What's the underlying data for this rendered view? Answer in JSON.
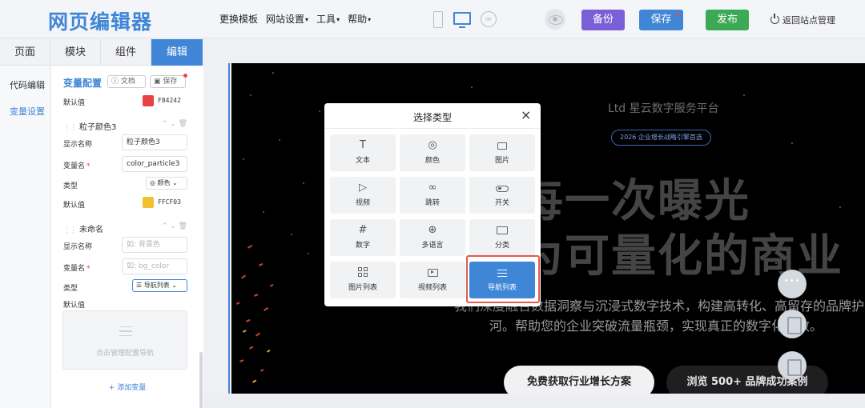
{
  "app": {
    "logo": "网页编辑器"
  },
  "topbar": {
    "menu": [
      {
        "label": "更换模板",
        "caret": ""
      },
      {
        "label": "网站设置",
        "caret": "▾"
      },
      {
        "label": "工具",
        "caret": "▾"
      },
      {
        "label": "帮助",
        "caret": "▾"
      }
    ],
    "backup_label": "备份",
    "save_label": "保存",
    "publish_label": "发布",
    "back_label": "返回站点管理",
    "active_device": "desktop",
    "colors": {
      "backup": "#7b5fd6",
      "save": "#3f86d6",
      "publish": "#3caa55"
    }
  },
  "sidebar": {
    "tabs": [
      "页面",
      "模块",
      "组件",
      "编辑"
    ],
    "active_tab": "编辑",
    "subnav": [
      "代码编辑",
      "变量设置"
    ],
    "active_subnav": "变量设置",
    "panel": {
      "title": "变量配置",
      "doc_label": "文档",
      "save_label": "保存",
      "default_label": "默认值",
      "top_default": {
        "color": "#E84242",
        "value": "F84242"
      },
      "groups": [
        {
          "name": "粒子颜色3",
          "display_label": "显示名称",
          "display_value": "粒子颜色3",
          "var_label": "变量名",
          "var_value": "color_particle3",
          "type_label": "类型",
          "type_value": "颜色",
          "default_label": "默认值",
          "default_color": "#F2C12E",
          "default_value": "FFCF03"
        },
        {
          "name": "未命名",
          "display_label": "显示名称",
          "display_placeholder": "如: 背景色",
          "var_label": "变量名",
          "var_placeholder": "如: bg_color",
          "type_label": "类型",
          "type_value": "导航列表",
          "default_label": "默认值",
          "textarea_hint": "点击管理配置导航"
        }
      ],
      "add_label": "+ 添加变量"
    }
  },
  "preview": {
    "brand": "Ltd 星云数字服务平台",
    "badge": "2026 企业增长战略引擎首选",
    "headline1": "让每一次曝光",
    "headline2": "转为可量化的商业",
    "para1": "我们深度融合数据洞察与沉浸式数字技术，构建高转化、高留存的品牌护",
    "para2": "河。帮助您的企业突破流量瓶颈，实现真正的数字化增效。",
    "cta_primary": "免费获取行业增长方案",
    "cta_secondary": "浏览 500+ 品牌成功案例"
  },
  "modal": {
    "title": "选择类型",
    "close": "×",
    "selected": "导航列表",
    "types": [
      {
        "label": "文本",
        "icon": "text-icon"
      },
      {
        "label": "颜色",
        "icon": "color-icon"
      },
      {
        "label": "图片",
        "icon": "image-icon"
      },
      {
        "label": "视频",
        "icon": "video-icon"
      },
      {
        "label": "跳转",
        "icon": "link-icon"
      },
      {
        "label": "开关",
        "icon": "switch-icon"
      },
      {
        "label": "数字",
        "icon": "number-icon"
      },
      {
        "label": "多语言",
        "icon": "globe-icon"
      },
      {
        "label": "分类",
        "icon": "folder-icon"
      },
      {
        "label": "图片列表",
        "icon": "image-list-icon"
      },
      {
        "label": "视频列表",
        "icon": "video-list-icon"
      },
      {
        "label": "导航列表",
        "icon": "nav-list-icon"
      }
    ]
  }
}
